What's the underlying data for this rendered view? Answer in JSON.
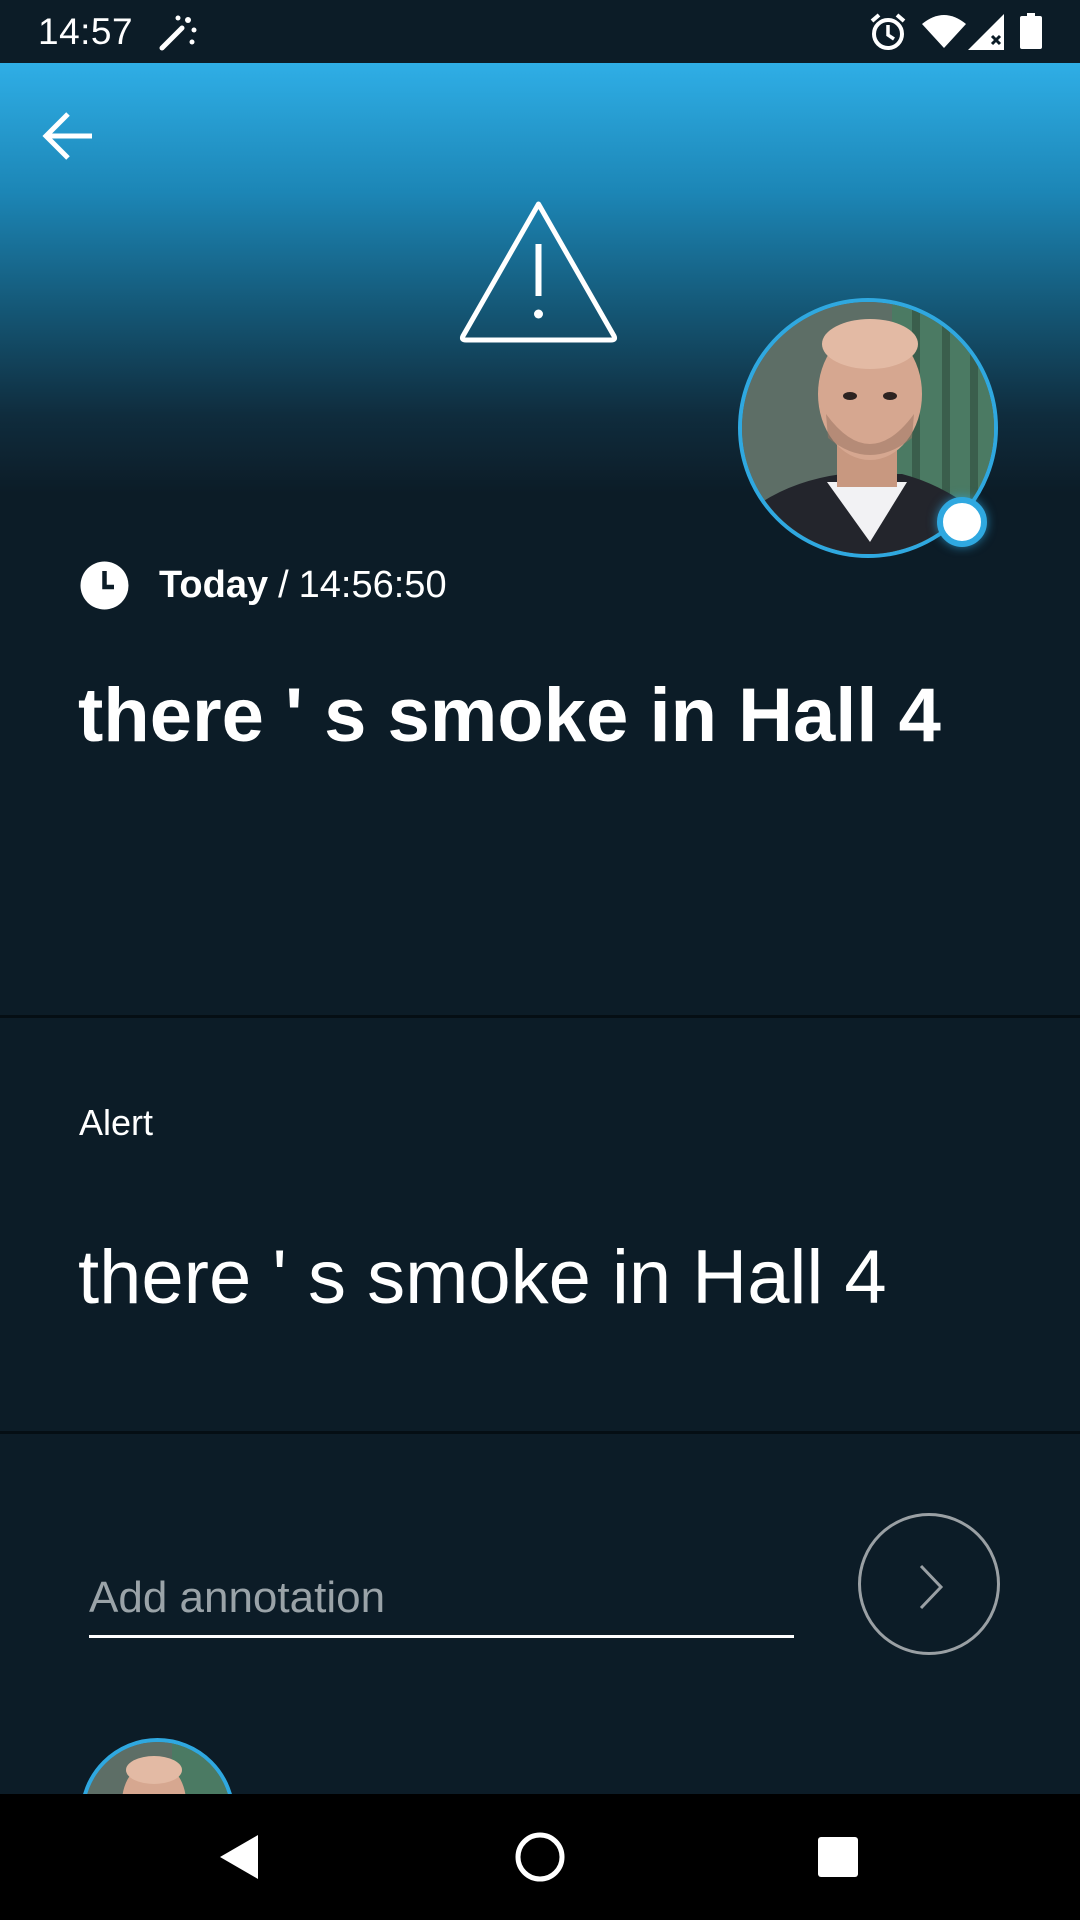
{
  "status_bar": {
    "time": "14:57",
    "icons": [
      "magic-wand-icon",
      "alarm-icon",
      "wifi-icon",
      "signal-icon",
      "battery-icon"
    ]
  },
  "header": {
    "back_icon": "arrow-left-icon",
    "alert_icon": "warning-triangle-icon",
    "avatar": "person-photo",
    "online_status": "online"
  },
  "event": {
    "day": "Today",
    "separator": "/",
    "time": "14:56:50",
    "title": "there ' s smoke in Hall 4"
  },
  "detail": {
    "type_label": "Alert",
    "message": "there ' s smoke in Hall 4"
  },
  "annotation": {
    "placeholder": "Add annotation",
    "send_icon": "chevron-right-icon"
  },
  "navigation_bar": {
    "buttons": [
      "back-triangle-icon",
      "home-circle-icon",
      "recents-square-icon"
    ]
  },
  "colors": {
    "background": "#0c1c27",
    "accent": "#2fa8e0",
    "header_top": "#2faee6"
  }
}
